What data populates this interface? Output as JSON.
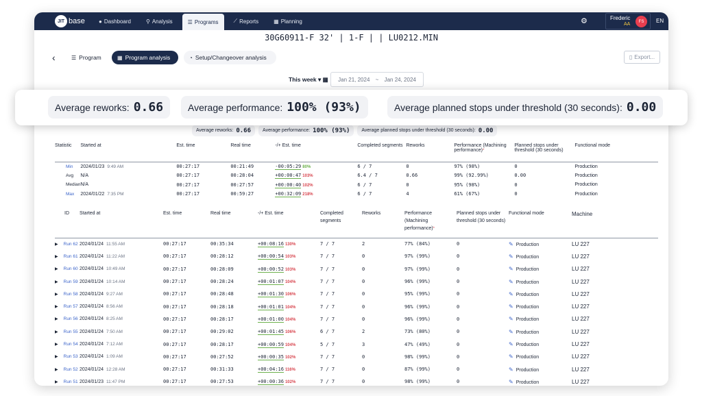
{
  "app": {
    "logo_mark": "JIT",
    "logo_text": "base",
    "nav": [
      {
        "label": "Dashboard",
        "icon": "●"
      },
      {
        "label": "Analysis",
        "icon": "⚲"
      },
      {
        "label": "Programs",
        "icon": "☰"
      },
      {
        "label": "Reports",
        "icon": "⟋"
      },
      {
        "label": "Planning",
        "icon": "▦"
      }
    ],
    "user": {
      "name": "Frederic",
      "sub": "AA",
      "initials": "FS"
    },
    "lang": "EN"
  },
  "page": {
    "title": "30G60911-F 32' | 1-F | | LU0212.MIN",
    "tabs": {
      "program": "Program",
      "analysis": "Program analysis",
      "setup": "Setup/Changeover analysis"
    },
    "export": "Export...",
    "week": "This week",
    "date_from": "Jan 21, 2024",
    "date_sep": "~",
    "date_to": "Jan 24, 2024"
  },
  "summary": {
    "avg_reworks_label": "Average reworks:",
    "avg_reworks": "0.66",
    "avg_perf_label": "Average performance:",
    "avg_perf": "100% (93%)",
    "avg_stops_label": "Average planned stops under threshold (30 seconds):",
    "avg_stops": "0.00"
  },
  "stats_table": {
    "headers": [
      "Statistic",
      "Started at",
      "Est. time",
      "Real time",
      "-/+ Est. time",
      "Completed segments",
      "Reworks",
      "Machining performance)",
      "Planned stops under threshold (30 seconds)",
      "Functional mode"
    ],
    "perf_header": "Performance",
    "rows": [
      {
        "stat": "Min",
        "date": "2024/01/23",
        "time": "9:49 AM",
        "est": "00:27:17",
        "real": "00:21:49",
        "delta": "-00:05:29",
        "pct": "80%",
        "pct_color": "green",
        "segs": "6 / 7",
        "reworks": "0",
        "perf": "97% (98%)",
        "stops": "0",
        "mode": "Production"
      },
      {
        "stat": "Avg",
        "date": "N/A",
        "time": "",
        "est": "00:27:17",
        "real": "00:28:04",
        "delta": "+00:00:47",
        "pct": "103%",
        "pct_color": "red",
        "segs": "6.4 / 7",
        "reworks": "0.66",
        "perf": "99% (92.99%)",
        "stops": "0.00",
        "mode": "Production"
      },
      {
        "stat": "Median",
        "date": "N/A",
        "time": "",
        "est": "00:27:17",
        "real": "00:27:57",
        "delta": "+00:00:40",
        "pct": "102%",
        "pct_color": "red",
        "segs": "6 / 7",
        "reworks": "0",
        "perf": "95% (98%)",
        "stops": "0",
        "mode": "Production"
      },
      {
        "stat": "Max",
        "date": "2024/01/22",
        "time": "7:35 PM",
        "est": "00:27:17",
        "real": "00:59:27",
        "delta": "+00:32:09",
        "pct": "218%",
        "pct_color": "red",
        "segs": "6 / 7",
        "reworks": "4",
        "perf": "61% (67%)",
        "stops": "0",
        "mode": "Production"
      }
    ]
  },
  "runs_table": {
    "headers": {
      "id": "ID",
      "started": "Started at",
      "est": "Est. time",
      "real": "Real time",
      "delta": "-/+ Est. time",
      "segs1": "Completed",
      "segs2": "segments",
      "reworks": "Reworks",
      "perf1": "Performance",
      "perf2": "(Machining",
      "perf3": "performance)",
      "stops1": "Planned stops under",
      "stops2": "threshold (30 seconds)",
      "mode": "Functional mode",
      "machine": "Machine"
    },
    "rows": [
      {
        "id": "Run 62",
        "date": "2024/01/24",
        "time": "11:55 AM",
        "est": "00:27:17",
        "real": "00:35:34",
        "delta": "+00:08:16",
        "pct": "130%",
        "segs": "7 / 7",
        "reworks": "2",
        "perf": "77% (84%)",
        "stops": "0",
        "mode": "Production",
        "machine": "LU 227"
      },
      {
        "id": "Run 61",
        "date": "2024/01/24",
        "time": "11:22 AM",
        "est": "00:27:17",
        "real": "00:28:12",
        "delta": "+00:00:54",
        "pct": "103%",
        "segs": "7 / 7",
        "reworks": "0",
        "perf": "97% (99%)",
        "stops": "0",
        "mode": "Production",
        "machine": "LU 227"
      },
      {
        "id": "Run 60",
        "date": "2024/01/24",
        "time": "10:49 AM",
        "est": "00:27:17",
        "real": "00:28:09",
        "delta": "+00:00:52",
        "pct": "103%",
        "segs": "7 / 7",
        "reworks": "0",
        "perf": "97% (99%)",
        "stops": "0",
        "mode": "Production",
        "machine": "LU 227"
      },
      {
        "id": "Run 59",
        "date": "2024/01/24",
        "time": "10:14 AM",
        "est": "00:27:17",
        "real": "00:28:24",
        "delta": "+00:01:07",
        "pct": "104%",
        "segs": "7 / 7",
        "reworks": "0",
        "perf": "96% (99%)",
        "stops": "0",
        "mode": "Production",
        "machine": "LU 227"
      },
      {
        "id": "Run 58",
        "date": "2024/01/24",
        "time": "9:27 AM",
        "est": "00:27:17",
        "real": "00:28:48",
        "delta": "+00:01:30",
        "pct": "106%",
        "segs": "7 / 7",
        "reworks": "0",
        "perf": "95% (99%)",
        "stops": "0",
        "mode": "Production",
        "machine": "LU 227"
      },
      {
        "id": "Run 57",
        "date": "2024/01/24",
        "time": "8:56 AM",
        "est": "00:27:17",
        "real": "00:28:18",
        "delta": "+00:01:01",
        "pct": "104%",
        "segs": "7 / 7",
        "reworks": "0",
        "perf": "96% (99%)",
        "stops": "0",
        "mode": "Production",
        "machine": "LU 227"
      },
      {
        "id": "Run 56",
        "date": "2024/01/24",
        "time": "8:25 AM",
        "est": "00:27:17",
        "real": "00:28:17",
        "delta": "+00:01:00",
        "pct": "104%",
        "segs": "7 / 7",
        "reworks": "0",
        "perf": "96% (99%)",
        "stops": "0",
        "mode": "Production",
        "machine": "LU 227"
      },
      {
        "id": "Run 55",
        "date": "2024/01/24",
        "time": "7:50 AM",
        "est": "00:27:17",
        "real": "00:29:02",
        "delta": "+00:01:45",
        "pct": "106%",
        "segs": "6 / 7",
        "reworks": "2",
        "perf": "73% (80%)",
        "stops": "0",
        "mode": "Production",
        "machine": "LU 227"
      },
      {
        "id": "Run 54",
        "date": "2024/01/24",
        "time": "7:12 AM",
        "est": "00:27:17",
        "real": "00:28:17",
        "delta": "+00:00:59",
        "pct": "104%",
        "segs": "5 / 7",
        "reworks": "3",
        "perf": "47% (49%)",
        "stops": "0",
        "mode": "Production",
        "machine": "LU 227"
      },
      {
        "id": "Run 53",
        "date": "2024/01/24",
        "time": "1:09 AM",
        "est": "00:27:17",
        "real": "00:27:52",
        "delta": "+00:00:35",
        "pct": "102%",
        "segs": "7 / 7",
        "reworks": "0",
        "perf": "98% (99%)",
        "stops": "0",
        "mode": "Production",
        "machine": "LU 227"
      },
      {
        "id": "Run 52",
        "date": "2024/01/24",
        "time": "12:28 AM",
        "est": "00:27:17",
        "real": "00:31:33",
        "delta": "+00:04:16",
        "pct": "116%",
        "segs": "7 / 7",
        "reworks": "0",
        "perf": "87% (99%)",
        "stops": "0",
        "mode": "Production",
        "machine": "LU 227"
      },
      {
        "id": "Run 51",
        "date": "2024/01/23",
        "time": "11:47 PM",
        "est": "00:27:17",
        "real": "00:27:53",
        "delta": "+00:00:36",
        "pct": "102%",
        "segs": "7 / 7",
        "reworks": "0",
        "perf": "98% (99%)",
        "stops": "0",
        "mode": "Production",
        "machine": "LU 227"
      }
    ]
  },
  "colors": {
    "navy": "#1c2b4b",
    "link": "#3a63c9",
    "red": "#d8454e",
    "green": "#6bb04a"
  }
}
